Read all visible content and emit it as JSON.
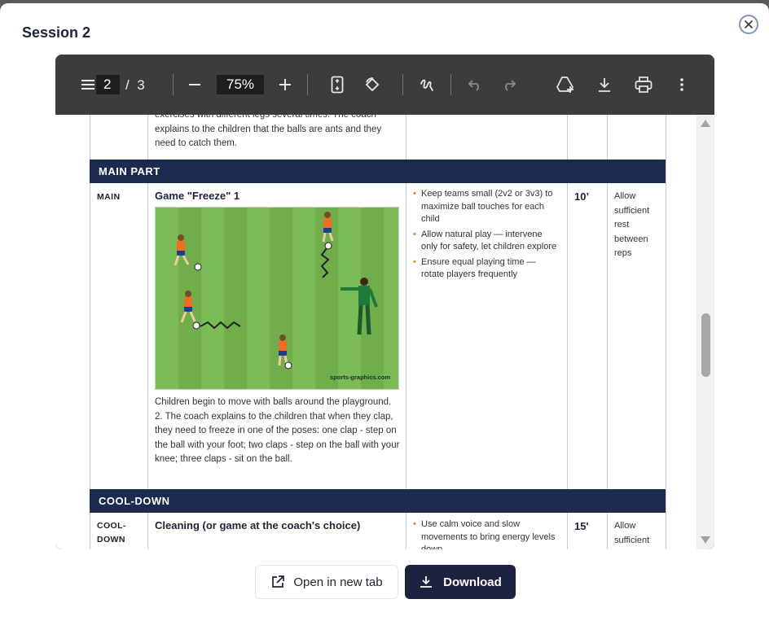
{
  "modal": {
    "title": "Session 2"
  },
  "toolbar": {
    "current_page": "2",
    "page_separator": "/",
    "total_pages": "3",
    "zoom": "75%"
  },
  "table": {
    "intro_text": "exercises with different legs several times. The coach explains to the children that the balls are ants and they need to catch them.",
    "sections": [
      {
        "band": "MAIN PART",
        "phase": "MAIN",
        "title": "Game \"Freeze\" 1",
        "image_caption": "sports-graphics.com",
        "description": "Children begin to move with balls around the playground. 2. The coach explains to the children that when they clap, they need to freeze in one of the poses: one clap - step on the ball with your foot; two claps - step on the ball with your knee; three claps - sit on the ball.",
        "tips": [
          "Keep teams small (2v2 or 3v3) to maximize ball touches for each child",
          "Allow natural play — intervene only for safety, let children explore",
          "Ensure equal playing time — rotate players frequently"
        ],
        "duration": "10’",
        "note": "Allow sufficient rest between reps"
      },
      {
        "band": "COOL-DOWN",
        "phase": "COOL-DOWN",
        "title": "Cleaning (or game at the coach's choice)",
        "tips": [
          "Use calm voice and slow movements to bring energy levels down"
        ],
        "duration": "15'",
        "note": "Allow sufficient rest"
      }
    ]
  },
  "actions": {
    "open_label": "Open in new tab",
    "download_label": "Download"
  },
  "colors": {
    "band_bg": "#1b2a4e",
    "bullet": "#e9892c",
    "download_bg": "#1b2340"
  }
}
